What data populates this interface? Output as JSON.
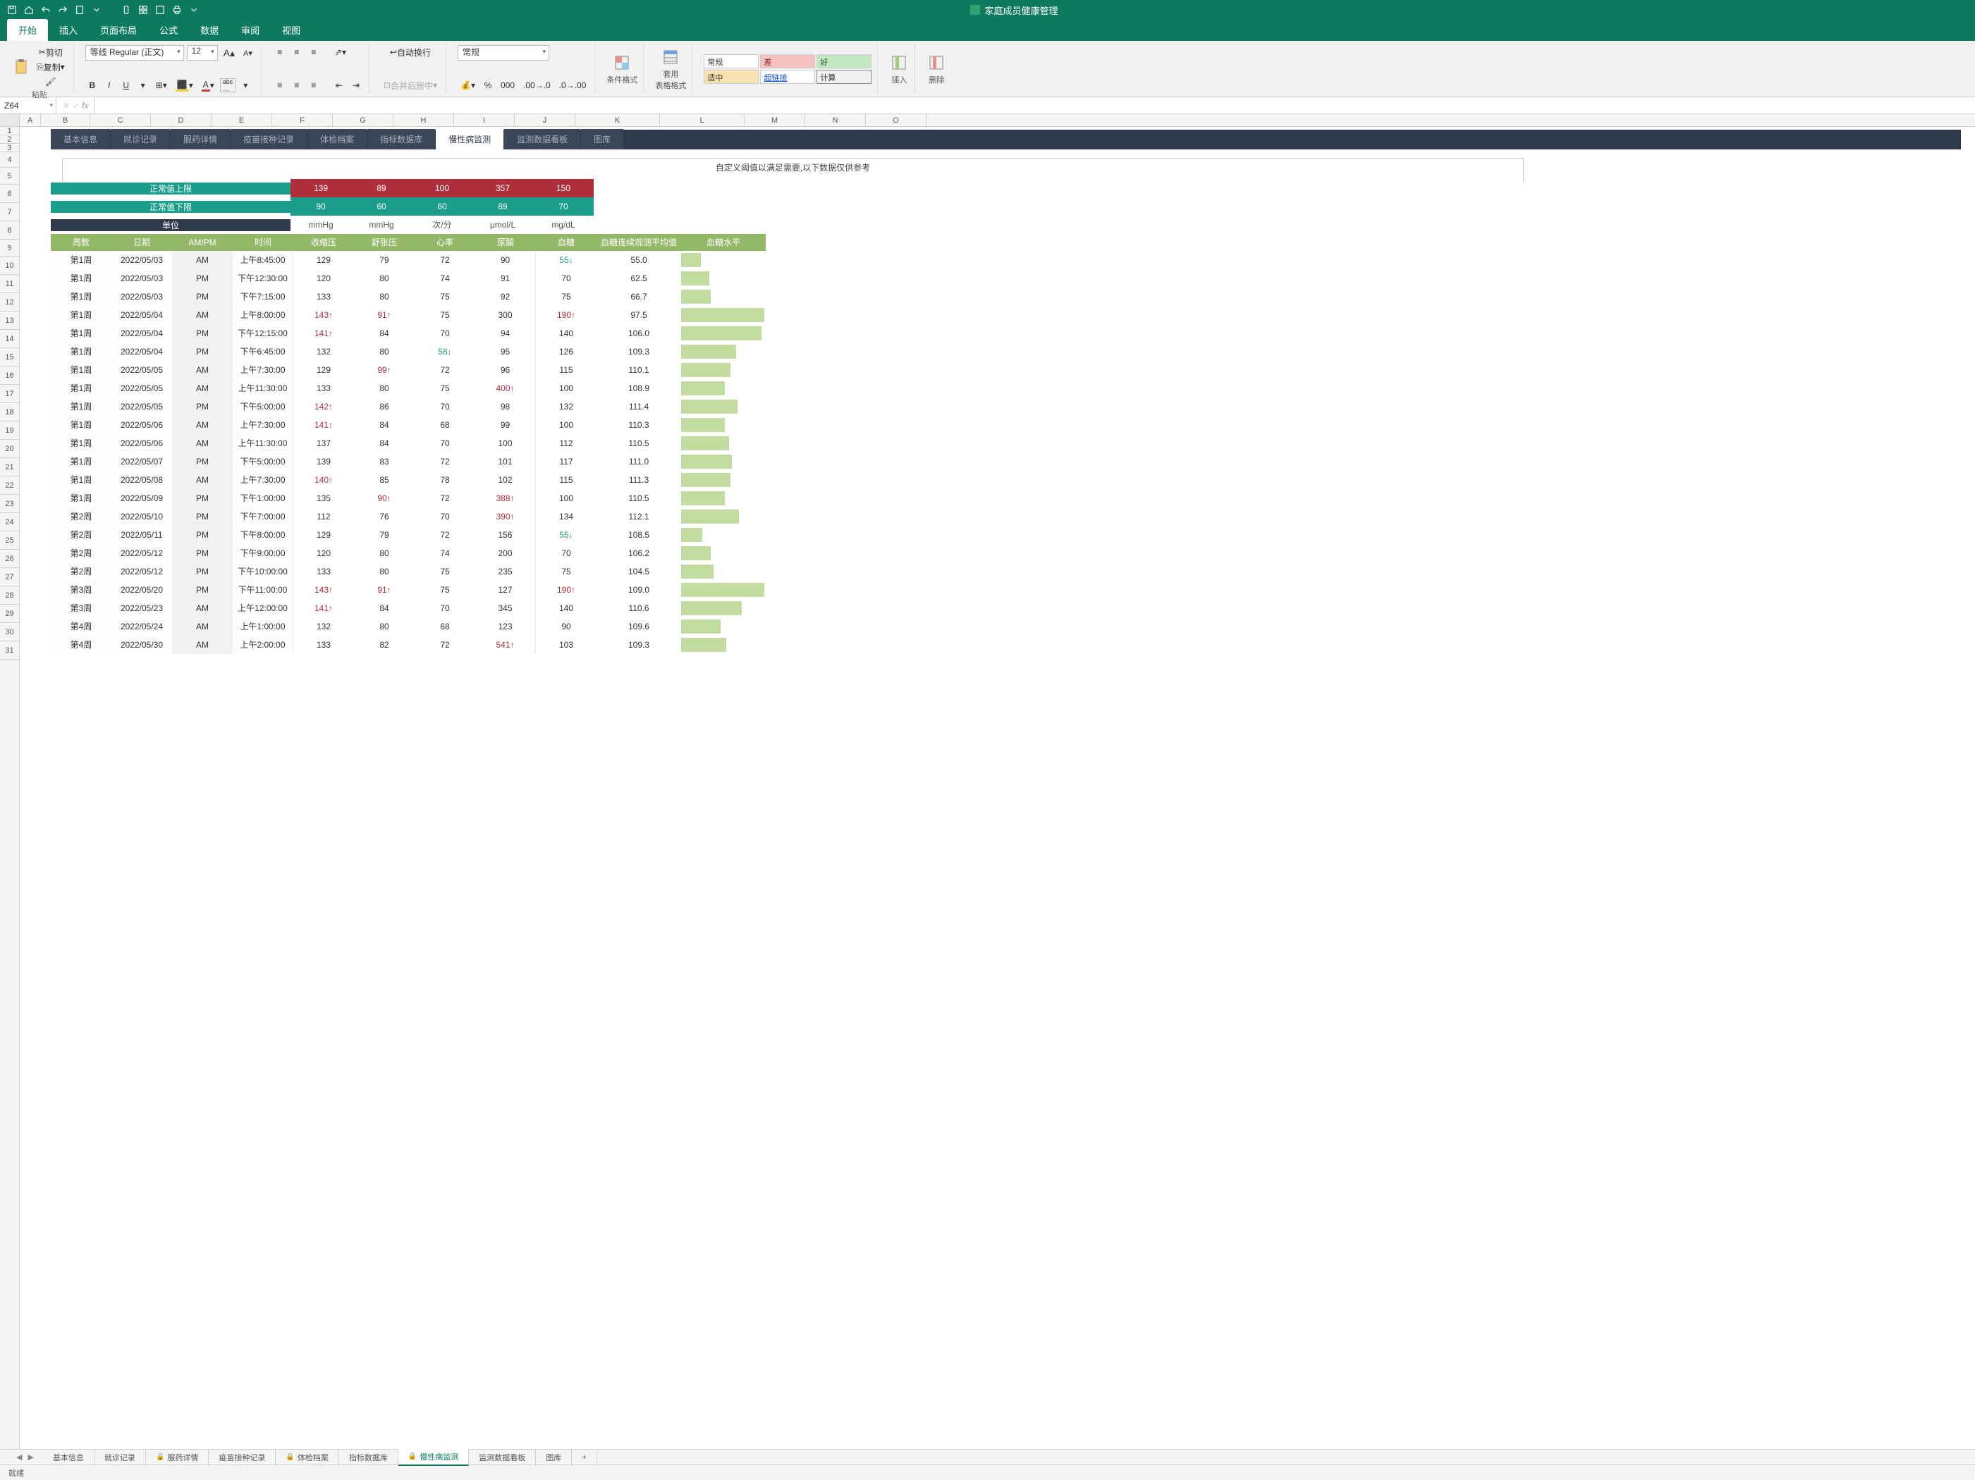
{
  "title": "家庭成员健康管理",
  "menu": {
    "tabs": [
      "开始",
      "插入",
      "页面布局",
      "公式",
      "数据",
      "审阅",
      "视图"
    ],
    "active": 0
  },
  "ribbon": {
    "clipboard": {
      "cut": "剪切",
      "copy": "复制",
      "brush": "",
      "paste": "粘贴"
    },
    "font": {
      "name": "等线 Regular (正文)",
      "size": "12",
      "bold": "B",
      "italic": "I",
      "underline": "U",
      "biglabel": "A",
      "smalllabel": "A"
    },
    "align": {
      "wrap": "自动换行",
      "merge": "合并后居中"
    },
    "number": {
      "format": "常规",
      "percent": "%",
      "comma": "000"
    },
    "cond": {
      "label": "条件格式"
    },
    "tablefmt": {
      "label": "套用\n表格格式"
    },
    "styles": {
      "a": "常规",
      "b": "差",
      "c": "好",
      "d": "适中",
      "e": "超链接",
      "f": "计算"
    },
    "insert": "插入",
    "delete": "删除"
  },
  "fbar": {
    "name": "Z64",
    "fx": "fx"
  },
  "cols": [
    "A",
    "B",
    "C",
    "D",
    "E",
    "F",
    "G",
    "H",
    "I",
    "J",
    "K",
    "L",
    "M",
    "N",
    "O"
  ],
  "rows_small": [
    "1",
    "2",
    "3"
  ],
  "rows": [
    "4",
    "5",
    "6",
    "7",
    "8",
    "9",
    "10",
    "11",
    "12",
    "13",
    "14",
    "15",
    "16",
    "17",
    "18",
    "19",
    "20",
    "21",
    "22",
    "23",
    "24",
    "25",
    "26",
    "27",
    "28",
    "29",
    "30",
    "31"
  ],
  "navtabs": [
    "基本信息",
    "就诊记录",
    "服药详情",
    "疫苗接种记录",
    "体检档案",
    "指标数据库",
    "慢性病监测",
    "监测数据看板",
    "图库"
  ],
  "navactive": 6,
  "caption": "自定义阈值以满足需要,以下数据仅供参考",
  "limits": {
    "upLabel": "正常值上限",
    "loLabel": "正常值下限",
    "unitLabel": "单位",
    "up": [
      "139",
      "89",
      "100",
      "357",
      "150"
    ],
    "lo": [
      "90",
      "60",
      "60",
      "89",
      "70"
    ],
    "unit": [
      "mmHg",
      "mmHg",
      "次/分",
      "μmol/L",
      "mg/dL"
    ]
  },
  "headers": [
    "周数",
    "日期",
    "AM/PM",
    "时间",
    "收缩压",
    "舒张压",
    "心率",
    "尿酸",
    "血糖",
    "血糖连续观测平均值",
    "血糖水平"
  ],
  "data": [
    {
      "w": "第1周",
      "d": "2022/05/03",
      "ap": "AM",
      "t": "上午8:45:00",
      "sbp": "129",
      "dbp": "79",
      "hr": "72",
      "ua": "90",
      "bg": "55",
      "bgf": "lo",
      "avg": "55.0",
      "bar": 28
    },
    {
      "w": "第1周",
      "d": "2022/05/03",
      "ap": "PM",
      "t": "下午12:30:00",
      "sbp": "120",
      "dbp": "80",
      "hr": "74",
      "ua": "91",
      "bg": "70",
      "avg": "62.5",
      "bar": 40
    },
    {
      "w": "第1周",
      "d": "2022/05/03",
      "ap": "PM",
      "t": "下午7:15:00",
      "sbp": "133",
      "dbp": "80",
      "hr": "75",
      "ua": "92",
      "bg": "75",
      "avg": "66.7",
      "bar": 42
    },
    {
      "w": "第1周",
      "d": "2022/05/04",
      "ap": "AM",
      "t": "上午8:00:00",
      "sbp": "143",
      "sbpf": "hi",
      "dbp": "91",
      "dbpf": "hi",
      "hr": "75",
      "ua": "300",
      "bg": "190",
      "bgf": "hi",
      "avg": "97.5",
      "bar": 118
    },
    {
      "w": "第1周",
      "d": "2022/05/04",
      "ap": "PM",
      "t": "下午12:15:00",
      "sbp": "141",
      "sbpf": "hi",
      "dbp": "84",
      "hr": "70",
      "ua": "94",
      "bg": "140",
      "avg": "106.0",
      "bar": 114
    },
    {
      "w": "第1周",
      "d": "2022/05/04",
      "ap": "PM",
      "t": "下午6:45:00",
      "sbp": "132",
      "dbp": "80",
      "hr": "58",
      "hrf": "lo",
      "ua": "95",
      "bg": "126",
      "avg": "109.3",
      "bar": 78
    },
    {
      "w": "第1周",
      "d": "2022/05/05",
      "ap": "AM",
      "t": "上午7:30:00",
      "sbp": "129",
      "dbp": "99",
      "dbpf": "hi",
      "hr": "72",
      "ua": "96",
      "bg": "115",
      "avg": "110.1",
      "bar": 70
    },
    {
      "w": "第1周",
      "d": "2022/05/05",
      "ap": "AM",
      "t": "上午11:30:00",
      "sbp": "133",
      "dbp": "80",
      "hr": "75",
      "ua": "400",
      "uaf": "hi",
      "bg": "100",
      "avg": "108.9",
      "bar": 62
    },
    {
      "w": "第1周",
      "d": "2022/05/05",
      "ap": "PM",
      "t": "下午5:00:00",
      "sbp": "142",
      "sbpf": "hi",
      "dbp": "86",
      "hr": "70",
      "ua": "98",
      "bg": "132",
      "avg": "111.4",
      "bar": 80
    },
    {
      "w": "第1周",
      "d": "2022/05/06",
      "ap": "AM",
      "t": "上午7:30:00",
      "sbp": "141",
      "sbpf": "hi",
      "dbp": "84",
      "hr": "68",
      "ua": "99",
      "bg": "100",
      "avg": "110.3",
      "bar": 62
    },
    {
      "w": "第1周",
      "d": "2022/05/06",
      "ap": "AM",
      "t": "上午11:30:00",
      "sbp": "137",
      "dbp": "84",
      "hr": "70",
      "ua": "100",
      "bg": "112",
      "avg": "110.5",
      "bar": 68
    },
    {
      "w": "第1周",
      "d": "2022/05/07",
      "ap": "PM",
      "t": "下午5:00:00",
      "sbp": "139",
      "dbp": "83",
      "hr": "72",
      "ua": "101",
      "bg": "117",
      "avg": "111.0",
      "bar": 72
    },
    {
      "w": "第1周",
      "d": "2022/05/08",
      "ap": "AM",
      "t": "上午7:30:00",
      "sbp": "140",
      "sbpf": "hi",
      "dbp": "85",
      "hr": "78",
      "ua": "102",
      "bg": "115",
      "avg": "111.3",
      "bar": 70
    },
    {
      "w": "第1周",
      "d": "2022/05/09",
      "ap": "PM",
      "t": "下午1:00:00",
      "sbp": "135",
      "dbp": "90",
      "dbpf": "hi",
      "hr": "72",
      "ua": "388",
      "uaf": "hi",
      "bg": "100",
      "avg": "110.5",
      "bar": 62
    },
    {
      "w": "第2周",
      "d": "2022/05/10",
      "ap": "PM",
      "t": "下午7:00:00",
      "sbp": "112",
      "dbp": "76",
      "hr": "70",
      "ua": "390",
      "uaf": "hi",
      "bg": "134",
      "avg": "112.1",
      "bar": 82
    },
    {
      "w": "第2周",
      "d": "2022/05/11",
      "ap": "PM",
      "t": "下午8:00:00",
      "sbp": "129",
      "dbp": "79",
      "hr": "72",
      "ua": "156",
      "bg": "55",
      "bgf": "lo",
      "avg": "108.5",
      "bar": 30
    },
    {
      "w": "第2周",
      "d": "2022/05/12",
      "ap": "PM",
      "t": "下午9:00:00",
      "sbp": "120",
      "dbp": "80",
      "hr": "74",
      "ua": "200",
      "bg": "70",
      "avg": "106.2",
      "bar": 42
    },
    {
      "w": "第2周",
      "d": "2022/05/12",
      "ap": "PM",
      "t": "下午10:00:00",
      "sbp": "133",
      "dbp": "80",
      "hr": "75",
      "ua": "235",
      "bg": "75",
      "avg": "104.5",
      "bar": 46
    },
    {
      "w": "第3周",
      "d": "2022/05/20",
      "ap": "PM",
      "t": "下午11:00:00",
      "sbp": "143",
      "sbpf": "hi",
      "dbp": "91",
      "dbpf": "hi",
      "hr": "75",
      "ua": "127",
      "bg": "190",
      "bgf": "hi",
      "avg": "109.0",
      "bar": 118
    },
    {
      "w": "第3周",
      "d": "2022/05/23",
      "ap": "AM",
      "t": "上午12:00:00",
      "sbp": "141",
      "sbpf": "hi",
      "dbp": "84",
      "hr": "70",
      "ua": "345",
      "bg": "140",
      "avg": "110.6",
      "bar": 86
    },
    {
      "w": "第4周",
      "d": "2022/05/24",
      "ap": "AM",
      "t": "上午1:00:00",
      "sbp": "132",
      "dbp": "80",
      "hr": "68",
      "ua": "123",
      "bg": "90",
      "avg": "109.6",
      "bar": 56
    },
    {
      "w": "第4周",
      "d": "2022/05/30",
      "ap": "AM",
      "t": "上午2:00:00",
      "sbp": "133",
      "dbp": "82",
      "hr": "72",
      "ua": "541",
      "uaf": "hi",
      "bg": "103",
      "avg": "109.3",
      "bar": 64
    }
  ],
  "sheettabs": [
    {
      "label": "基本信息"
    },
    {
      "label": "就诊记录"
    },
    {
      "label": "服药详情",
      "lock": true
    },
    {
      "label": "疫苗接种记录"
    },
    {
      "label": "体检档案",
      "lock": true
    },
    {
      "label": "指标数据库"
    },
    {
      "label": "慢性病监测",
      "lock": true,
      "active": true
    },
    {
      "label": "监测数据看板"
    },
    {
      "label": "图库"
    }
  ],
  "status": "就绪"
}
